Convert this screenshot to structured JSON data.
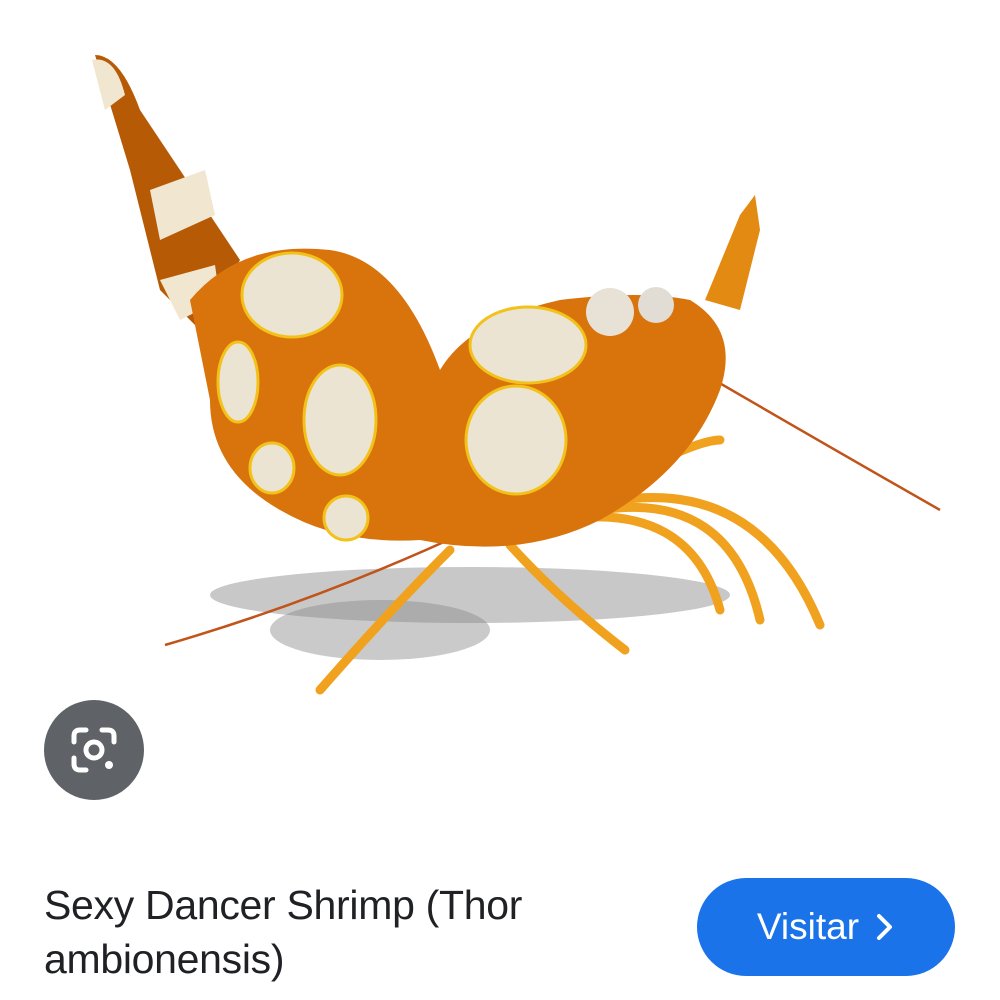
{
  "image": {
    "subject": "shrimp-photo",
    "colors": {
      "body": "#d9730c",
      "body_dark": "#b65a06",
      "spots": "#e9e2d2",
      "legs": "#f0a21e",
      "shadow": "#6b6b6b"
    }
  },
  "lens": {
    "icon": "google-lens-icon",
    "color": "#5f6368"
  },
  "result": {
    "title": "Sexy Dancer Shrimp (Thor ambionensis)",
    "visit_label": "Visitar",
    "visit_icon": "chevron-right-icon",
    "accent": "#1a73e8"
  }
}
